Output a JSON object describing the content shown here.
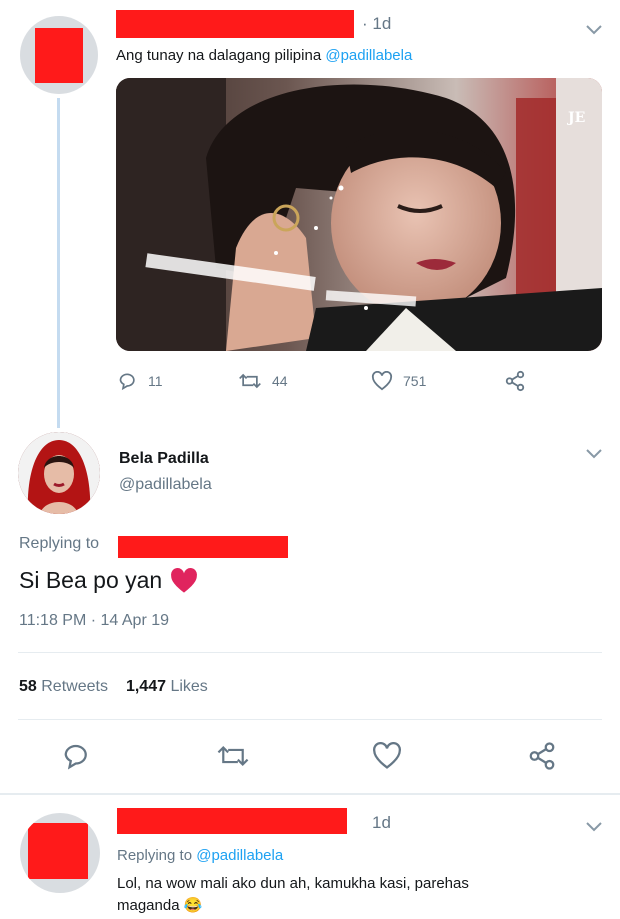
{
  "tweet1": {
    "time": "· 1d",
    "text": "Ang tunay na dalagang pilipina",
    "mention": "@padillabela",
    "photo_watermark": "JE",
    "replies": "11",
    "retweets": "44",
    "likes": "751"
  },
  "main_tweet": {
    "name": "Bela Padilla",
    "handle": "@padillabela",
    "replying_label": "Replying to",
    "text": "Si Bea po yan",
    "timestamp": "11:18 PM · 14 Apr 19",
    "retweet_count": "58",
    "retweet_label": "Retweets",
    "like_count": "1,447",
    "like_label": "Likes"
  },
  "tweet3": {
    "time": "1d",
    "replying_label": "Replying to",
    "mention": "@padillabela",
    "text_line1": "Lol, na wow mali ako dun ah, kamukha kasi, parehas",
    "text_line2": "maganda 😂"
  },
  "colors": {
    "redaction": "#ff1a1a",
    "accent": "#1da1f2",
    "secondary_text": "#657786",
    "heart": "#e0245e"
  }
}
